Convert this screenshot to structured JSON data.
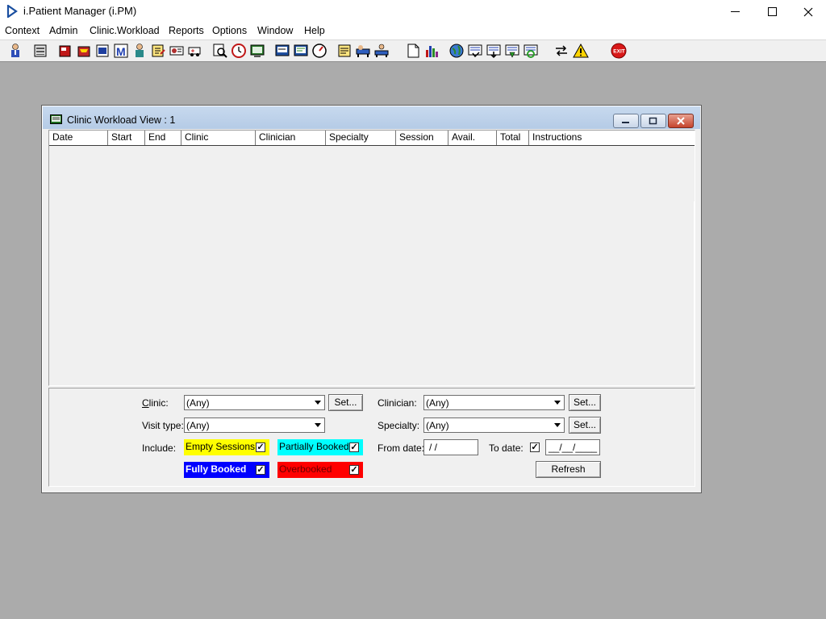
{
  "app": {
    "title": "i.Patient Manager (i.PM)"
  },
  "window_controls": {
    "minimize": "—",
    "maximize": "☐",
    "close": "✕"
  },
  "menu": [
    "Context",
    "Admin",
    "Clinic.Workload",
    "Reports",
    "Options",
    "Window",
    "Help"
  ],
  "toolbar": {
    "icons": [
      "patient-icon",
      "printer-icon",
      "book-icon",
      "folder-icon",
      "chart-icon",
      "m-icon",
      "doctor-icon",
      "edit-icon",
      "referral-icon",
      "ambulance-icon",
      "search-icon",
      "clock-icon",
      "monitor-icon",
      "screen-icon",
      "schedule-icon",
      "timer-icon",
      "note-icon",
      "transfer-icon",
      "admission-icon",
      "document-icon",
      "bar-chart-icon",
      "globe-icon",
      "list-check-icon",
      "list-down-icon",
      "list-green-icon",
      "list-refresh-icon",
      "swap-icon",
      "warning-icon",
      "exit-icon"
    ],
    "exit_label": "EXIT"
  },
  "child_window": {
    "title": "Clinic Workload View : 1",
    "columns": [
      "Date",
      "Start",
      "End",
      "Clinic",
      "Clinician",
      "Specialty",
      "Session",
      "Avail.",
      "Total",
      "Instructions"
    ]
  },
  "filters": {
    "clinic_label": "Clinic:",
    "clinic_value": "(Any)",
    "visit_type_label": "Visit type:",
    "visit_type_value": "(Any)",
    "include_label": "Include:",
    "clinician_label": "Clinician:",
    "clinician_value": "(Any)",
    "specialty_label": "Specialty:",
    "specialty_value": "(Any)",
    "set_label": "Set...",
    "from_date_label": "From date:",
    "from_date_value": " / /",
    "to_date_label": "To date:",
    "to_date_value": "__/__/____",
    "refresh_label": "Refresh",
    "sessions": {
      "empty": {
        "label": "Empty Sessions",
        "color": "#ffff00",
        "checked": true
      },
      "partial": {
        "label": "Partially Booked",
        "color": "#00ffff",
        "checked": true
      },
      "full": {
        "label": "Fully Booked",
        "color": "#0000ff",
        "checked": true
      },
      "over": {
        "label": "Overbooked",
        "color": "#ff0000",
        "checked": true
      }
    }
  }
}
